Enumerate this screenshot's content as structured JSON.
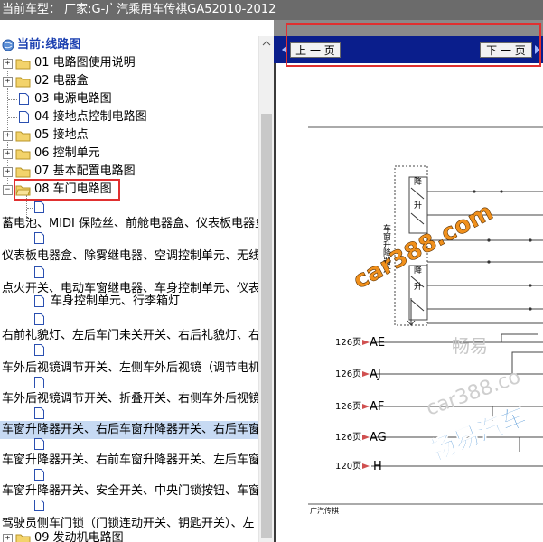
{
  "window": {
    "title": "当前车型：  厂家:G-广汽乘用车传祺GA52010-2012"
  },
  "tree": {
    "root_label": "当前:线路图",
    "items": [
      {
        "label": "01 电路图使用说明"
      },
      {
        "label": "02 电器盒"
      },
      {
        "label": "03 电源电路图"
      },
      {
        "label": "04 接地点控制电路图"
      },
      {
        "label": "05 接地点"
      },
      {
        "label": "06 控制单元"
      },
      {
        "label": "07 基本配置电路图"
      },
      {
        "label": "08 车门电路图"
      },
      {
        "label": "09 发动机电路图"
      }
    ],
    "sub_items": [
      {
        "label": "蓄电池、MIDI 保险丝、前舱电器盒、仪表板电器盒"
      },
      {
        "label": "仪表板电器盒、除雾继电器、空调控制单元、无线"
      },
      {
        "label": "点火开关、电动车窗继电器、车身控制单元、仪表"
      },
      {
        "label": "车身控制单元、行李箱灯"
      },
      {
        "label": "右前礼貌灯、左后车门未关开关、右后礼貌灯、右"
      },
      {
        "label": "车外后视镜调节开关、左侧车外后视镜（调节电机"
      },
      {
        "label": "车外后视镜调节开关、折叠开关、右侧车外后视镜"
      },
      {
        "label": "车窗升降器开关、右后车窗升降器开关、右后车窗"
      },
      {
        "label": "车窗升降器开关、右前车窗升降器开关、左后车窗"
      },
      {
        "label": "车窗升降器开关、安全开关、中央门锁按钮、车窗"
      },
      {
        "label": "驾驶员侧车门锁（门锁连动开关、钥匙开关）、左"
      }
    ]
  },
  "viewer": {
    "prev_label": "上 一 页",
    "next_label": "下 一 页",
    "diagram": {
      "vertical_label": "车窗升降器开",
      "switch_labels": [
        "降",
        "升",
        "降",
        "升"
      ],
      "connectors": [
        {
          "page": "126页",
          "code": "AE"
        },
        {
          "page": "126页",
          "code": "AJ"
        },
        {
          "page": "126页",
          "code": "AF"
        },
        {
          "page": "126页",
          "code": "AG"
        },
        {
          "page": "120页",
          "code": "H"
        }
      ],
      "footer": "广汽传祺",
      "watermark_main": "car388.com",
      "watermark_cn": "畅易汽车",
      "watermark_faint": "car388.co",
      "watermark_faint_cn": "畅易"
    }
  },
  "colors": {
    "title_bg": "#6b6b6b",
    "viewer_bar": "#0a1e8c",
    "selected_row": "#c7daf3",
    "highlight_box": "#e03030",
    "watermark_orange": "#f0901c",
    "watermark_blue": "#1a74c8"
  }
}
